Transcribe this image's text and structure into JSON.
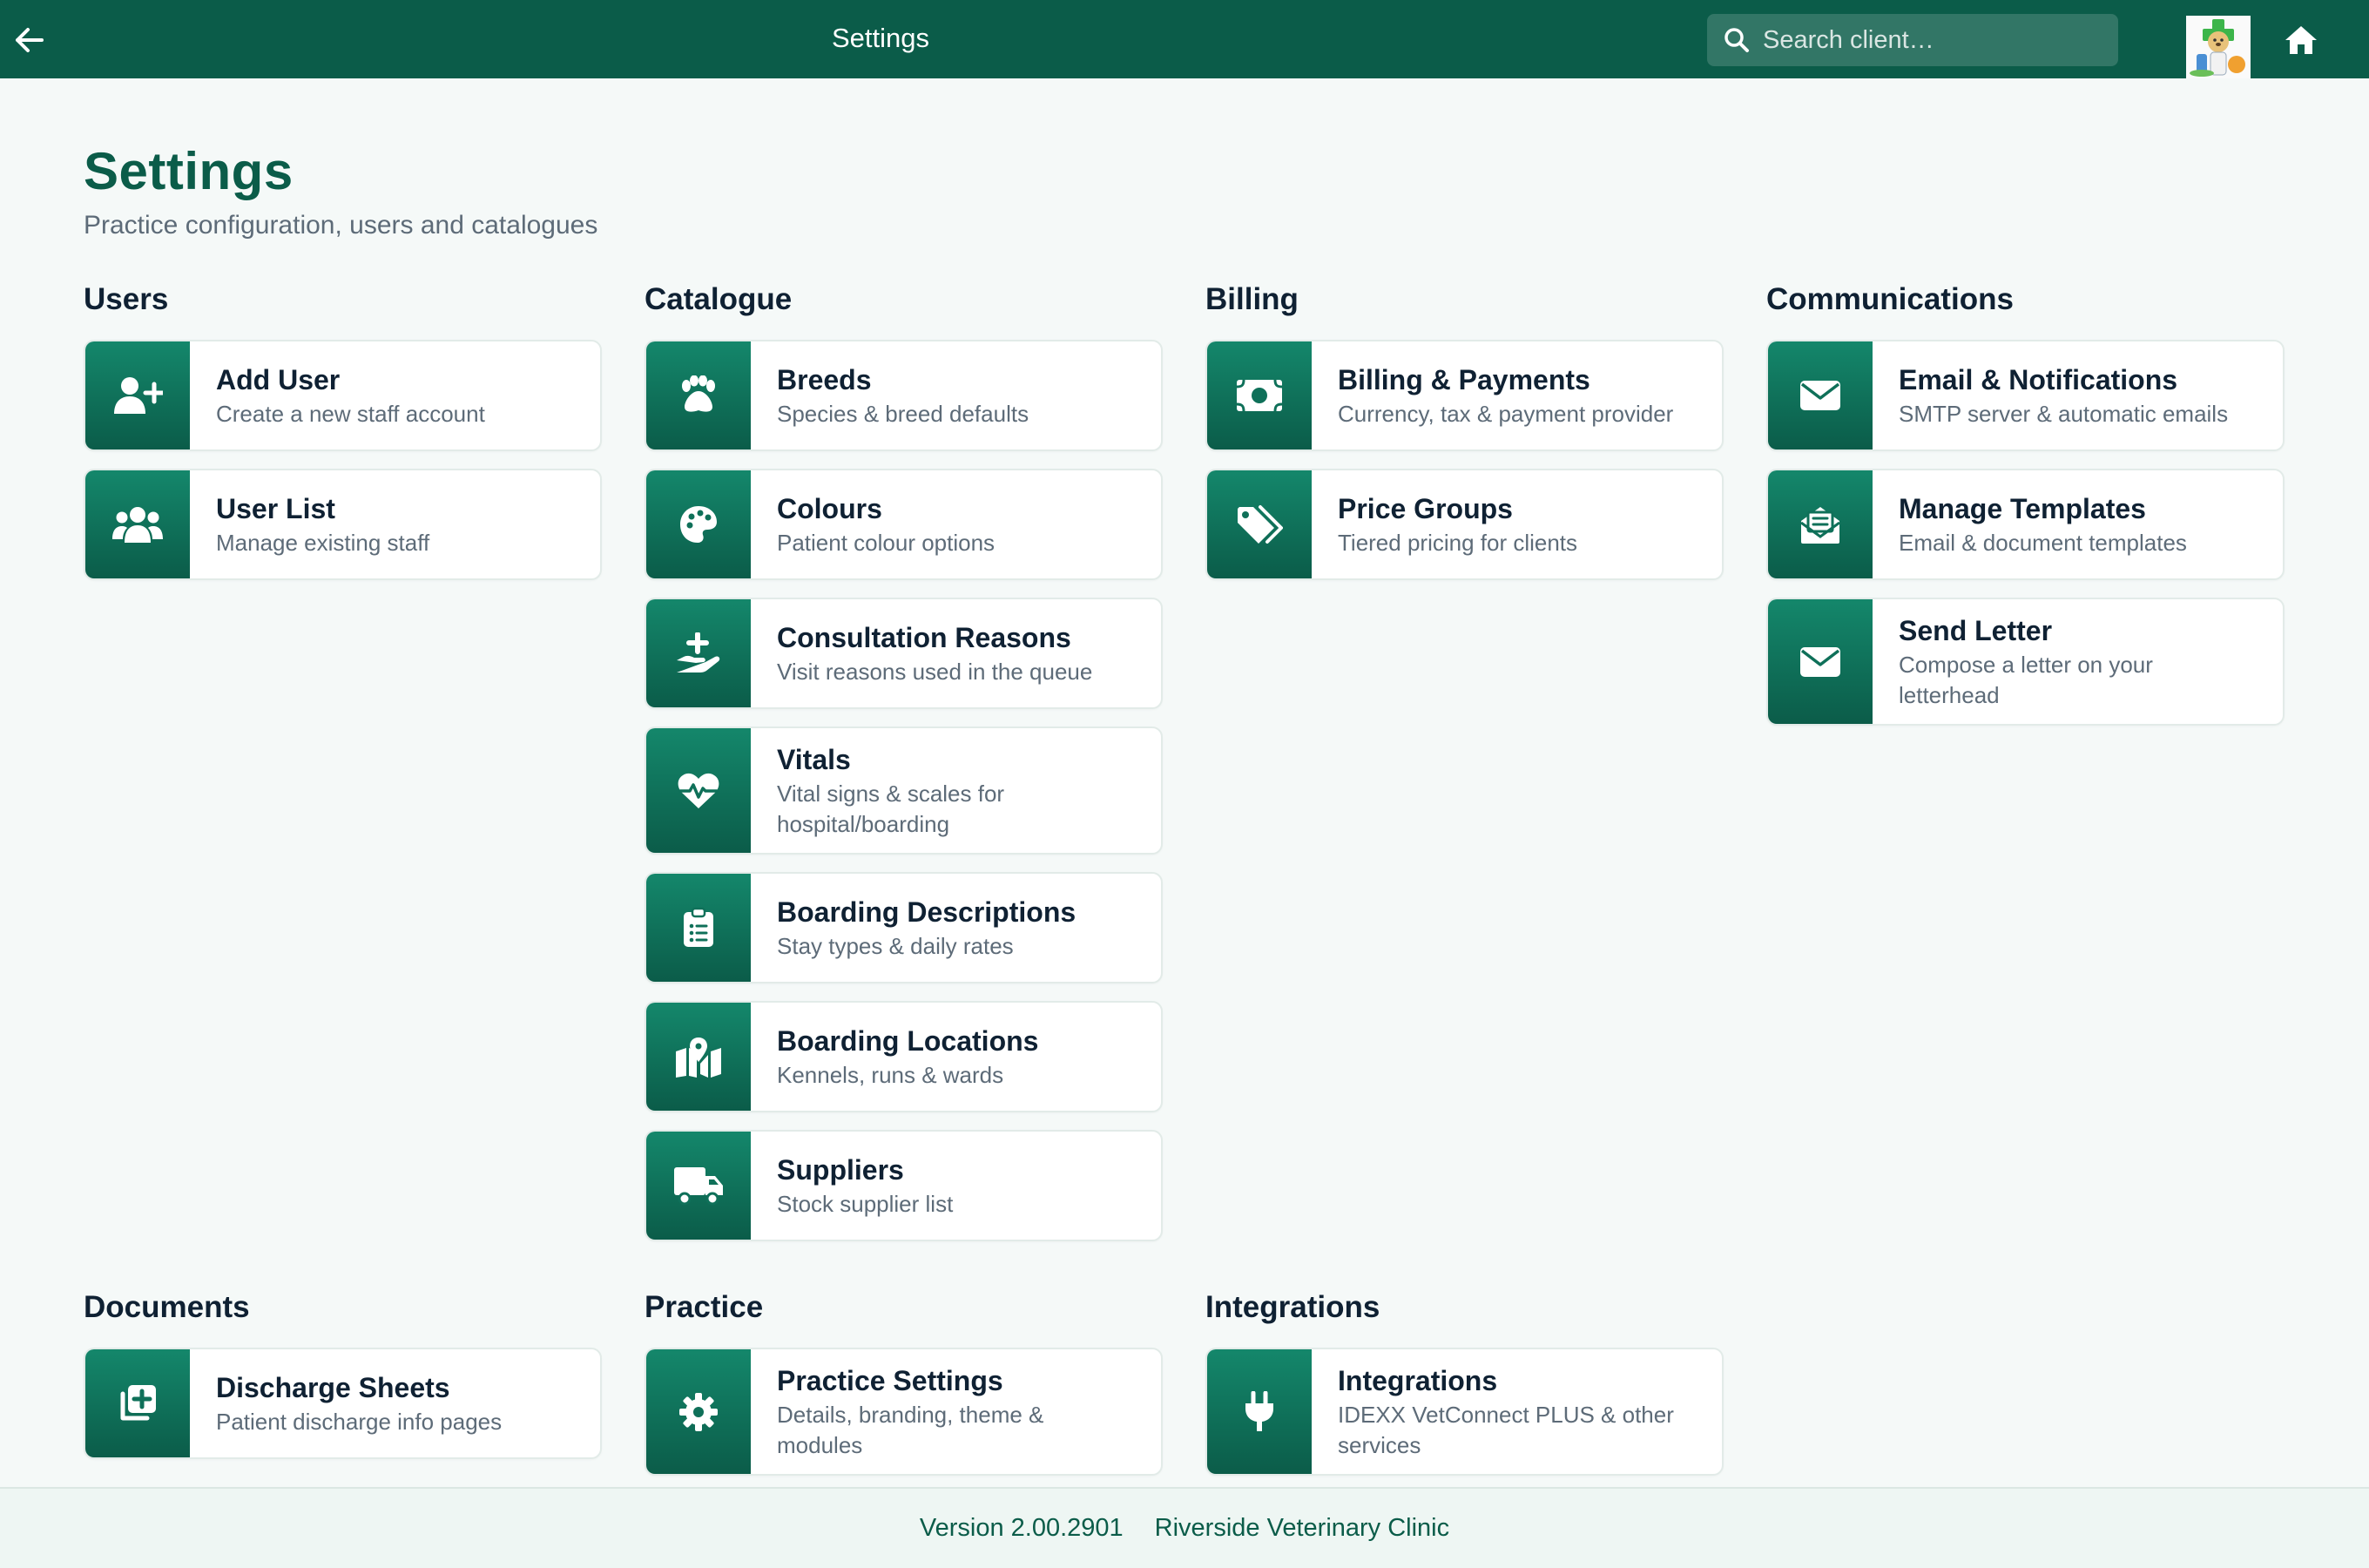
{
  "topbar": {
    "title": "Settings",
    "search_placeholder": "Search client…",
    "back_icon": "arrow-left-icon",
    "home_icon": "home-icon"
  },
  "header": {
    "title": "Settings",
    "subtitle": "Practice configuration, users and catalogues"
  },
  "sections": {
    "users": {
      "title": "Users",
      "items": [
        {
          "title": "Add User",
          "desc": "Create a new staff account",
          "icon": "user-plus-icon"
        },
        {
          "title": "User List",
          "desc": "Manage existing staff",
          "icon": "users-icon"
        }
      ]
    },
    "catalogue": {
      "title": "Catalogue",
      "items": [
        {
          "title": "Breeds",
          "desc": "Species & breed defaults",
          "icon": "paw-icon"
        },
        {
          "title": "Colours",
          "desc": "Patient colour options",
          "icon": "palette-icon"
        },
        {
          "title": "Consultation Reasons",
          "desc": "Visit reasons used in the queue",
          "icon": "hand-medical-icon"
        },
        {
          "title": "Vitals",
          "desc": "Vital signs & scales for hospital/boarding",
          "icon": "heart-pulse-icon"
        },
        {
          "title": "Boarding Descriptions",
          "desc": "Stay types & daily rates",
          "icon": "clipboard-list-icon"
        },
        {
          "title": "Boarding Locations",
          "desc": "Kennels, runs & wards",
          "icon": "map-location-icon"
        },
        {
          "title": "Suppliers",
          "desc": "Stock supplier list",
          "icon": "truck-icon"
        }
      ]
    },
    "billing": {
      "title": "Billing",
      "items": [
        {
          "title": "Billing & Payments",
          "desc": "Currency, tax & payment provider",
          "icon": "money-bill-icon"
        },
        {
          "title": "Price Groups",
          "desc": "Tiered pricing for clients",
          "icon": "tags-icon"
        }
      ]
    },
    "communications": {
      "title": "Communications",
      "items": [
        {
          "title": "Email & Notifications",
          "desc": "SMTP server & automatic emails",
          "icon": "envelope-icon"
        },
        {
          "title": "Manage Templates",
          "desc": "Email & document templates",
          "icon": "envelope-open-text-icon"
        },
        {
          "title": "Send Letter",
          "desc": "Compose a letter on your letterhead",
          "icon": "envelope-icon"
        }
      ]
    },
    "documents": {
      "title": "Documents",
      "items": [
        {
          "title": "Discharge Sheets",
          "desc": "Patient discharge info pages",
          "icon": "file-medical-icon"
        }
      ]
    },
    "practice": {
      "title": "Practice",
      "items": [
        {
          "title": "Practice Settings",
          "desc": "Details, branding, theme & modules",
          "icon": "gear-icon"
        }
      ]
    },
    "integrations": {
      "title": "Integrations",
      "items": [
        {
          "title": "Integrations",
          "desc": "IDEXX VetConnect PLUS & other services",
          "icon": "plug-icon"
        }
      ]
    }
  },
  "footer": {
    "version": "Version 2.00.2901",
    "clinic": "Riverside Veterinary Clinic"
  },
  "colors": {
    "primary": "#0b5c49",
    "accent": "#14876b",
    "background": "#f5f9f8"
  }
}
